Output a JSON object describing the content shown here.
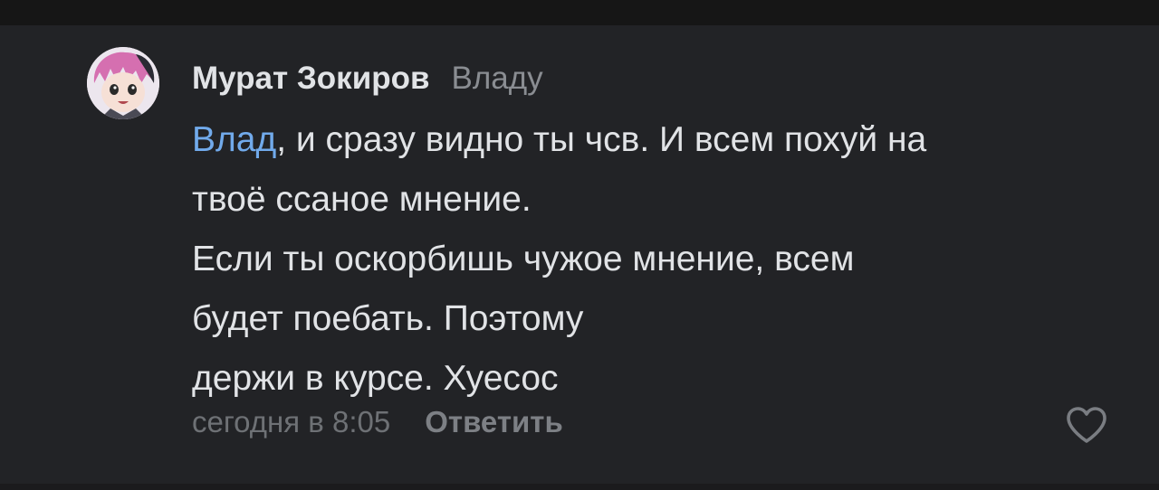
{
  "comment": {
    "author": "Мурат Зокиров",
    "reply_to": "Владу",
    "mention": "Влад",
    "lines": [
      ", и сразу видно ты чсв. И всем похуй на",
      "твоё ссаное мнение.",
      "Если ты оскорбишь чужое мнение, всем",
      "будет поебать. Поэтому",
      "держи в курсе. Хуесос"
    ],
    "timestamp": "сегодня в 8:05",
    "reply_label": "Ответить"
  },
  "icons": {
    "avatar": "anime-avatar-image",
    "like": "heart-outline-icon"
  },
  "colors": {
    "background": "#222326",
    "text": "#e1e3e6",
    "secondary": "#8a8d92",
    "link": "#71aaeb"
  }
}
